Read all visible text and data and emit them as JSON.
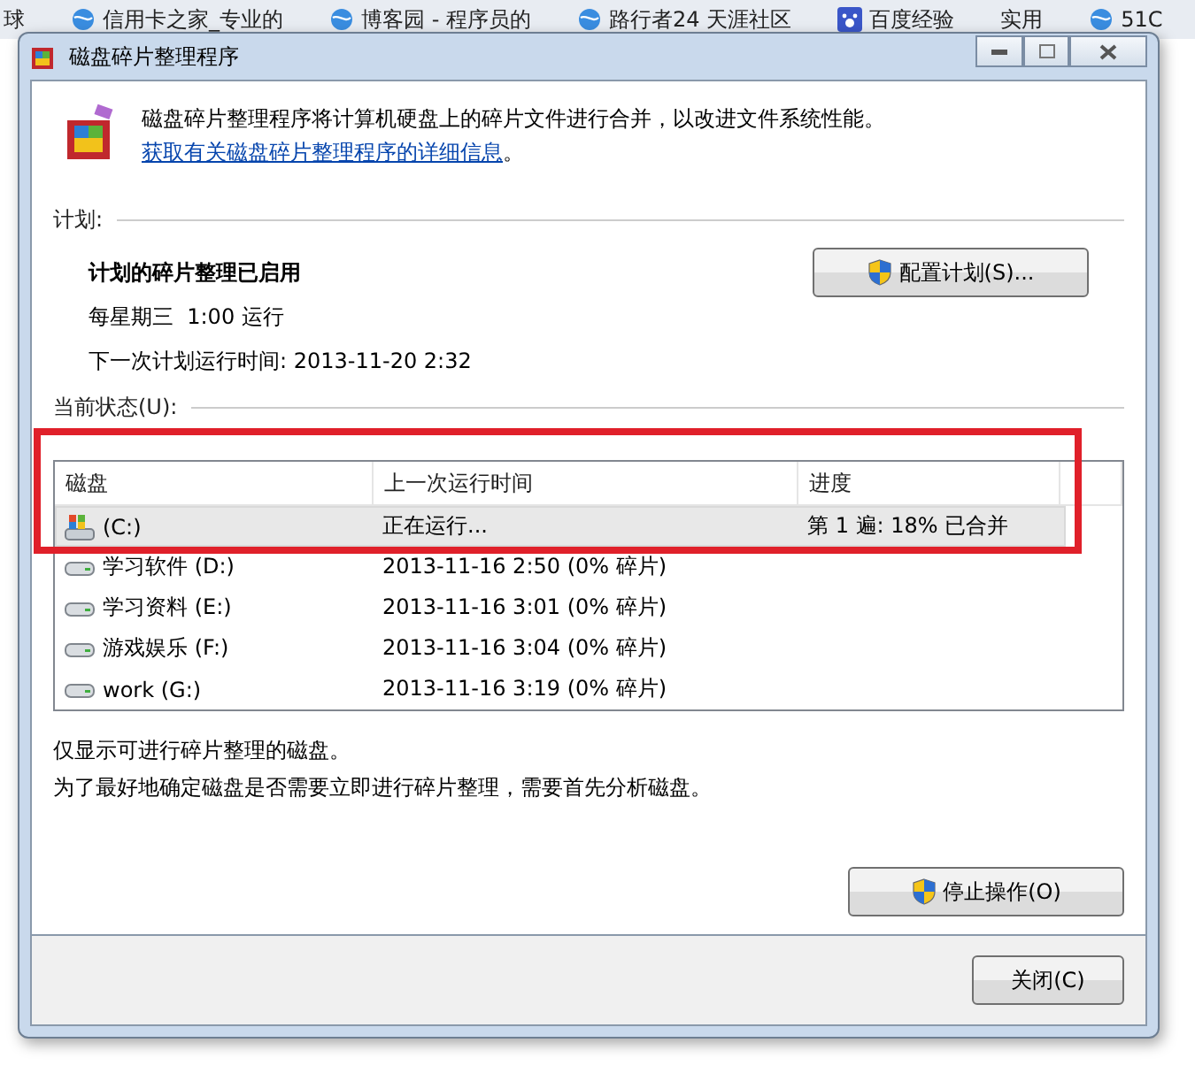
{
  "browser_tabs": [
    {
      "label": "球",
      "kind": "plain"
    },
    {
      "label": "信用卡之家_专业的",
      "kind": "globe"
    },
    {
      "label": "博客园 - 程序员的",
      "kind": "globe"
    },
    {
      "label": "路行者24 天涯社区",
      "kind": "globe"
    },
    {
      "label": "百度经验",
      "kind": "paw"
    },
    {
      "label": "实用",
      "kind": "plain"
    },
    {
      "label": "51C",
      "kind": "globe"
    }
  ],
  "window": {
    "title": "磁盘碎片整理程序"
  },
  "intro": {
    "text": "磁盘碎片整理程序将计算机硬盘上的碎片文件进行合并，以改进文件系统性能。",
    "link": "获取有关磁盘碎片整理程序的详细信息",
    "end": "。"
  },
  "schedule": {
    "heading": "计划:",
    "status": "计划的碎片整理已启用",
    "when": "每星期三  1:00 运行",
    "next_run": "下一次计划运行时间: 2013-11-20 2:32",
    "button": "配置计划(S)..."
  },
  "current_status": {
    "heading": "当前状态(U):",
    "columns": [
      "磁盘",
      "上一次运行时间",
      "进度"
    ],
    "rows": [
      {
        "kind": "system",
        "disk": "(C:)",
        "last_run": "正在运行...",
        "progress": "第 1 遍: 18% 已合并",
        "selected": true
      },
      {
        "kind": "drive",
        "disk": "学习软件 (D:)",
        "last_run": "2013-11-16 2:50 (0% 碎片)",
        "selected": false
      },
      {
        "kind": "drive",
        "disk": "学习资料 (E:)",
        "last_run": "2013-11-16 3:01 (0% 碎片)",
        "selected": false
      },
      {
        "kind": "drive",
        "disk": "游戏娱乐 (F:)",
        "last_run": "2013-11-16 3:04 (0% 碎片)",
        "selected": false
      },
      {
        "kind": "drive",
        "disk": "work (G:)",
        "last_run": "2013-11-16 3:19 (0% 碎片)",
        "selected": false
      }
    ]
  },
  "notes": [
    "仅显示可进行碎片整理的磁盘。",
    "为了最好地确定磁盘是否需要立即进行碎片整理，需要首先分析磁盘。"
  ],
  "stop_button": "停止操作(O)",
  "close_button": "关闭(C)"
}
